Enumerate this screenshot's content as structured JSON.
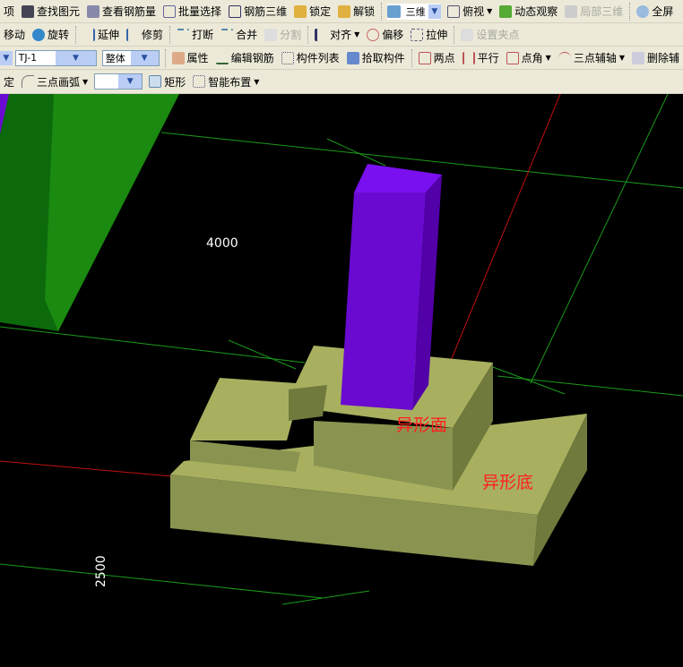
{
  "toolbar1": {
    "items": [
      "项",
      "查找图元",
      "查看钢筋量",
      "批量选择",
      "钢筋三维",
      "锁定",
      "解锁",
      "三维",
      "俯视",
      "动态观察",
      "局部三维",
      "全屏"
    ]
  },
  "toolbar2": {
    "items": [
      "移动",
      "旋转",
      "延伸",
      "修剪",
      "打断",
      "合并",
      "分割",
      "对齐",
      "偏移",
      "拉伸",
      "设置夹点"
    ]
  },
  "toolbar3": {
    "component": "TJ-1",
    "scope": "整体",
    "items": [
      "属性",
      "编辑钢筋",
      "构件列表",
      "拾取构件",
      "两点",
      "平行",
      "点角",
      "三点辅轴",
      "删除辅"
    ]
  },
  "toolbar4": {
    "items": [
      "定",
      "三点画弧",
      "",
      "矩形",
      "智能布置"
    ]
  },
  "viewport": {
    "dim_top": "4000",
    "dim_left": "2500",
    "label_face": "异形面",
    "label_base": "异形底"
  },
  "colors": {
    "column": "#6a0ad0",
    "footing": "#a8b060",
    "wall": "#1a8a10",
    "grid": "#1a9a1a",
    "axis": "#c01010",
    "label": "#ff2020"
  }
}
